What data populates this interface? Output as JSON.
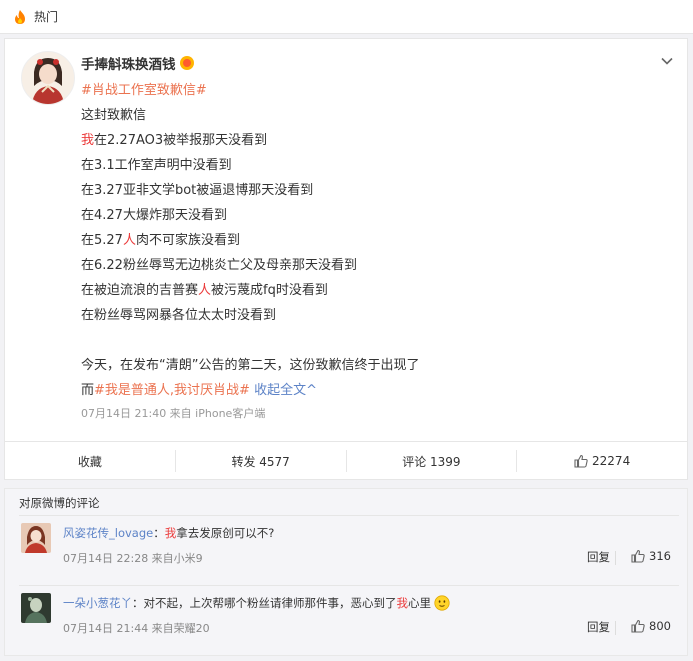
{
  "top_bar": {
    "title": "热门"
  },
  "post": {
    "username": "手捧斛珠换酒钱",
    "topic_tag": "#肖战工作室致歉信#",
    "lines": [
      {
        "segments": [
          {
            "text": "这封致歉信",
            "style": "normal"
          }
        ]
      },
      {
        "segments": [
          {
            "text": "我",
            "style": "red"
          },
          {
            "text": "在2.27AO3被举报那天没看到",
            "style": "normal"
          }
        ]
      },
      {
        "segments": [
          {
            "text": "在3.1工作室声明中没看到",
            "style": "normal"
          }
        ]
      },
      {
        "segments": [
          {
            "text": "在3.27亚非文学bot被逼退博那天没看到",
            "style": "normal"
          }
        ]
      },
      {
        "segments": [
          {
            "text": "在4.27大爆炸那天没看到",
            "style": "normal"
          }
        ]
      },
      {
        "segments": [
          {
            "text": "在5.27",
            "style": "normal"
          },
          {
            "text": "人",
            "style": "red"
          },
          {
            "text": "肉不可家族没看到",
            "style": "normal"
          }
        ]
      },
      {
        "segments": [
          {
            "text": "在6.22粉丝辱骂无边桃炎亡父及母亲那天没看到",
            "style": "normal"
          }
        ]
      },
      {
        "segments": [
          {
            "text": "在被迫流浪的吉普赛",
            "style": "normal"
          },
          {
            "text": "人",
            "style": "red"
          },
          {
            "text": "被污蔑成fq时没看到",
            "style": "normal"
          }
        ]
      },
      {
        "segments": [
          {
            "text": "在粉丝辱骂网暴各位太太时没看到",
            "style": "normal"
          }
        ]
      },
      {
        "segments": []
      },
      {
        "segments": [
          {
            "text": "今天，在发布“清朗”公告的第二天，这份致歉信终于出现了",
            "style": "normal"
          }
        ]
      },
      {
        "segments": [
          {
            "text": "而",
            "style": "normal"
          },
          {
            "text": "#我是普通人,我讨厌肖战#",
            "style": "orange"
          },
          {
            "text": " 收起全文",
            "style": "blue"
          },
          {
            "text": "^",
            "style": "blue"
          }
        ]
      }
    ],
    "meta": "07月14日 21:40  来自 iPhone客户端",
    "actions": {
      "favorite": "收藏",
      "repost": "转发 4577",
      "comment": "评论 1399",
      "like": "22274"
    }
  },
  "comments": {
    "header": "对原微博的评论",
    "items": [
      {
        "user": "风姿花传_lovage",
        "colon": "：",
        "text_segments": [
          {
            "text": "我",
            "style": "red"
          },
          {
            "text": "拿去发原创可以不?",
            "style": "normal"
          }
        ],
        "meta": "07月14日 22:28  来自小米9",
        "reply": "回复",
        "likes": "316"
      },
      {
        "user": "一朵小葱花丫",
        "colon": "：",
        "text_segments": [
          {
            "text": "对不起，上次帮哪个粉丝请律师那件事，恶心到了",
            "style": "normal"
          },
          {
            "text": "我",
            "style": "red"
          },
          {
            "text": "心里",
            "style": "normal"
          }
        ],
        "meta": "07月14日 21:44  来自荣耀20",
        "reply": "回复",
        "likes": "800"
      }
    ]
  },
  "colors": {
    "accent": "#eb7350",
    "red": "#eb3a3a",
    "link_blue": "#5d83c7"
  }
}
